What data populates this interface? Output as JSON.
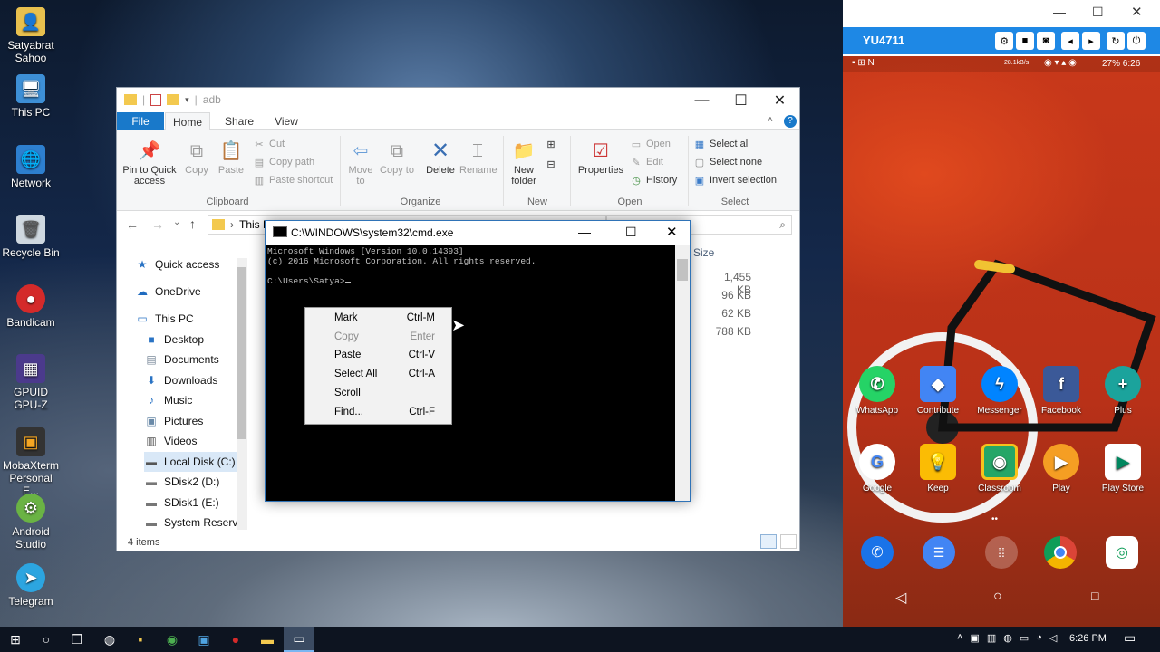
{
  "desktop": {
    "icons": [
      {
        "label": "Satyabrat Sahoo"
      },
      {
        "label": "This PC"
      },
      {
        "label": "Network"
      },
      {
        "label": "Recycle Bin"
      },
      {
        "label": "Bandicam"
      },
      {
        "label": "GPUID GPU-Z"
      },
      {
        "label": "MobaXterm Personal E..."
      },
      {
        "label": "Android Studio"
      },
      {
        "label": "Telegram"
      }
    ]
  },
  "explorer": {
    "title": "adb",
    "tabs": [
      "File",
      "Home",
      "Share",
      "View"
    ],
    "clipboard": {
      "pin": "Pin to Quick access",
      "copy": "Copy",
      "paste": "Paste",
      "cut": "Cut",
      "copy_path": "Copy path",
      "paste_shortcut": "Paste shortcut",
      "group": "Clipboard"
    },
    "organize": {
      "move": "Move to",
      "copy": "Copy to",
      "delete": "Delete",
      "rename": "Rename",
      "group": "Organize"
    },
    "new": {
      "new_folder": "New folder",
      "group": "New"
    },
    "open": {
      "properties": "Properties",
      "open": "Open",
      "edit": "Edit",
      "history": "History",
      "group": "Open"
    },
    "select": {
      "all": "Select all",
      "none": "Select none",
      "invert": "Invert selection",
      "group": "Select"
    },
    "address": "This P",
    "nav": [
      "Quick access",
      "OneDrive",
      "This PC",
      "Desktop",
      "Documents",
      "Downloads",
      "Music",
      "Pictures",
      "Videos",
      "Local Disk (C:)",
      "SDisk2 (D:)",
      "SDisk1 (E:)",
      "System Reservec"
    ],
    "size_header": "Size",
    "sizes": [
      "1,455 KB",
      "96 KB",
      "62 KB",
      "788 KB"
    ],
    "status": "4 items"
  },
  "cmd": {
    "title": "C:\\WINDOWS\\system32\\cmd.exe",
    "lines": [
      "Microsoft Windows [Version 10.0.14393]",
      "(c) 2016 Microsoft Corporation. All rights reserved.",
      "",
      "C:\\Users\\Satya>"
    ],
    "menu": [
      {
        "label": "Mark",
        "shortcut": "Ctrl-M"
      },
      {
        "label": "Copy",
        "shortcut": "Enter"
      },
      {
        "label": "Paste",
        "shortcut": "Ctrl-V"
      },
      {
        "label": "Select All",
        "shortcut": "Ctrl-A"
      },
      {
        "label": "Scroll",
        "shortcut": ""
      },
      {
        "label": "Find...",
        "shortcut": "Ctrl-F"
      }
    ]
  },
  "phone": {
    "device": "YU4711",
    "status_right": "27% 6:26",
    "speed": "28.1kB/s",
    "apps_row1": [
      "WhatsApp",
      "Contribute",
      "Messenger",
      "Facebook",
      "Plus"
    ],
    "apps_row2": [
      "Google",
      "Keep",
      "Classroom",
      "Play",
      "Play Store"
    ]
  },
  "taskbar": {
    "time": "6:26 PM"
  },
  "colors": {
    "accent": "#1979ca",
    "phone_header": "#1e88e5",
    "wallpaper_red": "#c8381a"
  }
}
